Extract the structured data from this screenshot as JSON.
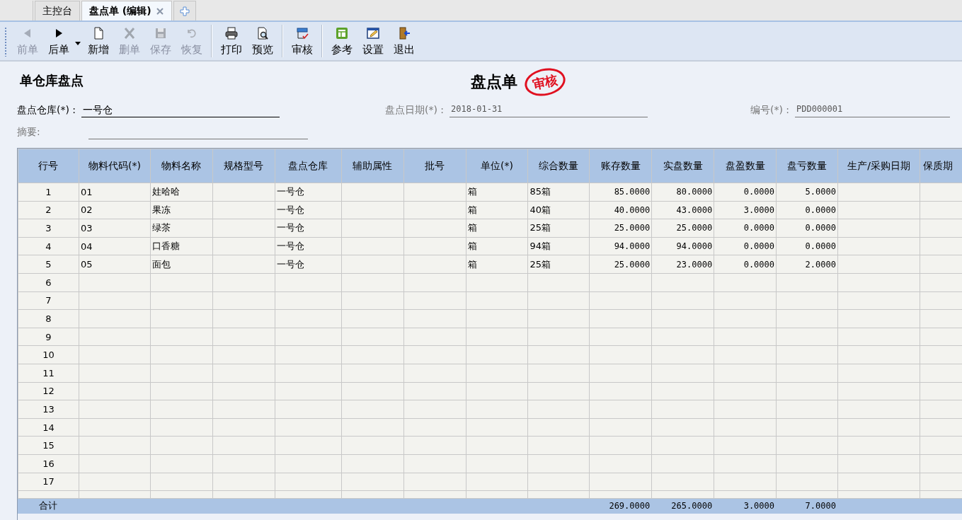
{
  "tabs": [
    {
      "label": "主控台",
      "selected": false,
      "closable": false
    },
    {
      "label": "盘点单 (编辑)",
      "selected": true,
      "closable": true
    }
  ],
  "toolbar": [
    {
      "label": "前单",
      "disabled": true,
      "has_menu": false
    },
    {
      "label": "后单",
      "disabled": false,
      "has_menu": true
    },
    {
      "label": "新增",
      "disabled": false,
      "has_menu": false
    },
    {
      "label": "删单",
      "disabled": true,
      "has_menu": false
    },
    {
      "label": "保存",
      "disabled": true,
      "has_menu": false
    },
    {
      "label": "恢复",
      "disabled": true,
      "has_menu": false
    },
    {
      "label": "打印",
      "disabled": false,
      "has_menu": false
    },
    {
      "label": "预览",
      "disabled": false,
      "has_menu": false
    },
    {
      "label": "审核",
      "disabled": false,
      "has_menu": false
    },
    {
      "label": "参考",
      "disabled": false,
      "has_menu": false
    },
    {
      "label": "设置",
      "disabled": false,
      "has_menu": false
    },
    {
      "label": "退出",
      "disabled": false,
      "has_menu": false
    }
  ],
  "form": {
    "subtitle": "单仓库盘点",
    "title": "盘点单",
    "stamp": "审核",
    "warehouse": {
      "label": "盘点仓库(*) :",
      "value": "一号仓"
    },
    "date": {
      "label": "盘点日期(*) :",
      "value": "2018-01-31"
    },
    "number": {
      "label": "编号(*) :",
      "value": "PDD000001"
    },
    "summary": {
      "label": "摘要:"
    }
  },
  "table": {
    "columns": [
      "行号",
      "物料代码(*)",
      "物料名称",
      "规格型号",
      "盘点仓库",
      "辅助属性",
      "批号",
      "单位(*)",
      "综合数量",
      "账存数量",
      "实盘数量",
      "盘盈数量",
      "盘亏数量",
      "生产/采购日期",
      "保质期"
    ],
    "rows": [
      [
        "1",
        "01",
        "娃哈哈",
        "",
        "一号仓",
        "",
        "",
        "箱",
        "85箱",
        "85.0000",
        "80.0000",
        "0.0000",
        "5.0000",
        "",
        ""
      ],
      [
        "2",
        "02",
        "果冻",
        "",
        "一号仓",
        "",
        "",
        "箱",
        "40箱",
        "40.0000",
        "43.0000",
        "3.0000",
        "0.0000",
        "",
        ""
      ],
      [
        "3",
        "03",
        "绿茶",
        "",
        "一号仓",
        "",
        "",
        "箱",
        "25箱",
        "25.0000",
        "25.0000",
        "0.0000",
        "0.0000",
        "",
        ""
      ],
      [
        "4",
        "04",
        "口香糖",
        "",
        "一号仓",
        "",
        "",
        "箱",
        "94箱",
        "94.0000",
        "94.0000",
        "0.0000",
        "0.0000",
        "",
        ""
      ],
      [
        "5",
        "05",
        "面包",
        "",
        "一号仓",
        "",
        "",
        "箱",
        "25箱",
        "25.0000",
        "23.0000",
        "0.0000",
        "2.0000",
        "",
        ""
      ],
      [
        "6",
        "",
        "",
        "",
        "",
        "",
        "",
        "",
        "",
        "",
        "",
        "",
        "",
        "",
        ""
      ],
      [
        "7",
        "",
        "",
        "",
        "",
        "",
        "",
        "",
        "",
        "",
        "",
        "",
        "",
        "",
        ""
      ],
      [
        "8",
        "",
        "",
        "",
        "",
        "",
        "",
        "",
        "",
        "",
        "",
        "",
        "",
        "",
        ""
      ],
      [
        "9",
        "",
        "",
        "",
        "",
        "",
        "",
        "",
        "",
        "",
        "",
        "",
        "",
        "",
        ""
      ],
      [
        "10",
        "",
        "",
        "",
        "",
        "",
        "",
        "",
        "",
        "",
        "",
        "",
        "",
        "",
        ""
      ],
      [
        "11",
        "",
        "",
        "",
        "",
        "",
        "",
        "",
        "",
        "",
        "",
        "",
        "",
        "",
        ""
      ],
      [
        "12",
        "",
        "",
        "",
        "",
        "",
        "",
        "",
        "",
        "",
        "",
        "",
        "",
        "",
        ""
      ],
      [
        "13",
        "",
        "",
        "",
        "",
        "",
        "",
        "",
        "",
        "",
        "",
        "",
        "",
        "",
        ""
      ],
      [
        "14",
        "",
        "",
        "",
        "",
        "",
        "",
        "",
        "",
        "",
        "",
        "",
        "",
        "",
        ""
      ],
      [
        "15",
        "",
        "",
        "",
        "",
        "",
        "",
        "",
        "",
        "",
        "",
        "",
        "",
        "",
        ""
      ],
      [
        "16",
        "",
        "",
        "",
        "",
        "",
        "",
        "",
        "",
        "",
        "",
        "",
        "",
        "",
        ""
      ],
      [
        "17",
        "",
        "",
        "",
        "",
        "",
        "",
        "",
        "",
        "",
        "",
        "",
        "",
        "",
        ""
      ]
    ],
    "total": {
      "label": "合计",
      "values": [
        "269.0000",
        "265.0000",
        "3.0000",
        "7.0000"
      ]
    }
  }
}
